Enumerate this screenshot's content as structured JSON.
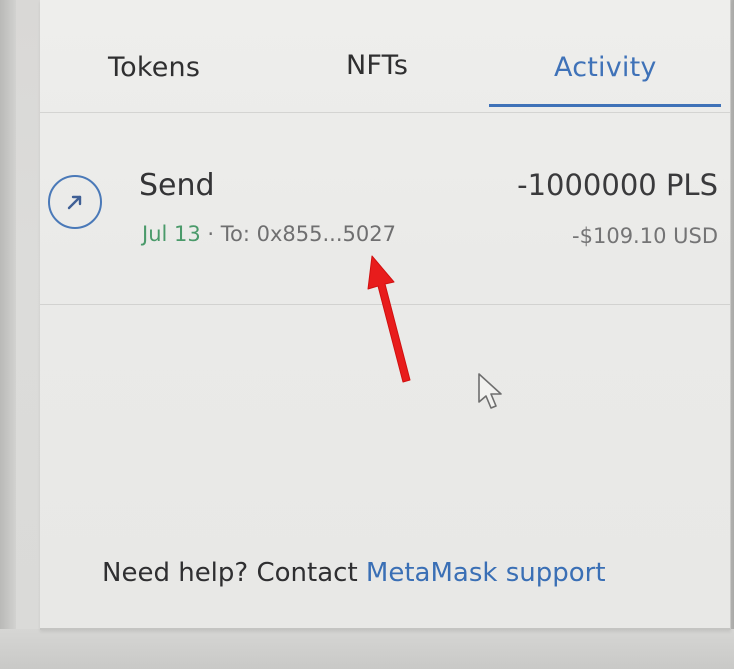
{
  "tabs": {
    "tokens": "Tokens",
    "nfts": "NFTs",
    "activity": "Activity",
    "active": "activity"
  },
  "transaction": {
    "icon": "arrow-up-right-icon",
    "title": "Send",
    "date": "Jul 13",
    "separator": " · ",
    "recipient": "To: 0x855...5027",
    "amount": "-1000000 PLS",
    "fiat_amount": "-$109.10 USD"
  },
  "help": {
    "prefix": "Need help? Contact ",
    "link": "MetaMask support"
  },
  "colors": {
    "accent": "#3f72b8",
    "date_green": "#4a9a6a",
    "annotation_red": "#e81c1c",
    "panel_bg": "#ebebe9"
  },
  "overlays": {
    "annotation": "red-arrow-icon",
    "pointer": "mouse-pointer-icon"
  }
}
